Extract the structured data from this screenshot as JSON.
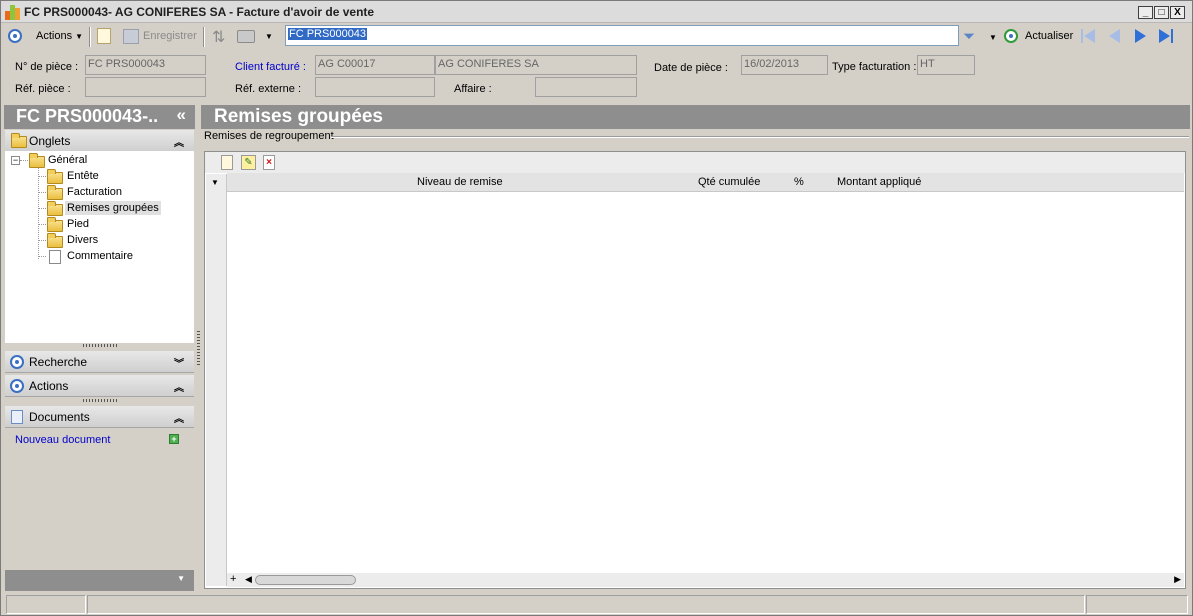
{
  "window": {
    "title": "FC PRS000043- AG CONIFERES SA - Facture d'avoir de vente",
    "controls": {
      "minimize": "_",
      "maximize": "□",
      "close": "X"
    }
  },
  "toolbar": {
    "actions_label": "Actions",
    "save_label": "Enregistrer",
    "search_value": "FC PRS000043",
    "refresh_label": "Actualiser"
  },
  "header_fields": {
    "numero_piece": {
      "label": "N° de pièce :",
      "value": "FC PRS000043"
    },
    "ref_piece": {
      "label": "Réf. pièce :",
      "value": ""
    },
    "client_facture": {
      "label": "Client facturé :",
      "code": "AG C00017",
      "name": "AG CONIFERES SA"
    },
    "ref_externe": {
      "label": "Réf. externe :",
      "value": ""
    },
    "affaire": {
      "label": "Affaire :",
      "value": ""
    },
    "date_piece": {
      "label": "Date de  pièce :",
      "value": "16/02/2013"
    },
    "type_facturation": {
      "label": "Type facturation :",
      "value": "HT"
    }
  },
  "left_panel": {
    "header": "FC PRS000043-..",
    "collapse_glyph": "«",
    "onglets_label": "Onglets",
    "tree": {
      "root": "Général",
      "items": [
        "Entête",
        "Facturation",
        "Remises groupées",
        "Pied",
        "Divers",
        "Commentaire"
      ]
    },
    "recherche_label": "Recherche",
    "actions_label": "Actions",
    "documents_label": "Documents",
    "new_document_label": "Nouveau document"
  },
  "main": {
    "title": "Remises groupées",
    "group_label": "Remises de regroupement",
    "grid_columns": [
      "Niveau de remise",
      "Qté cumulée",
      "%",
      "Montant appliqué"
    ],
    "rows": []
  },
  "colors": {
    "accent": "#3a6fc4",
    "header_bg": "#8e8e8e",
    "link": "#0000cc"
  }
}
